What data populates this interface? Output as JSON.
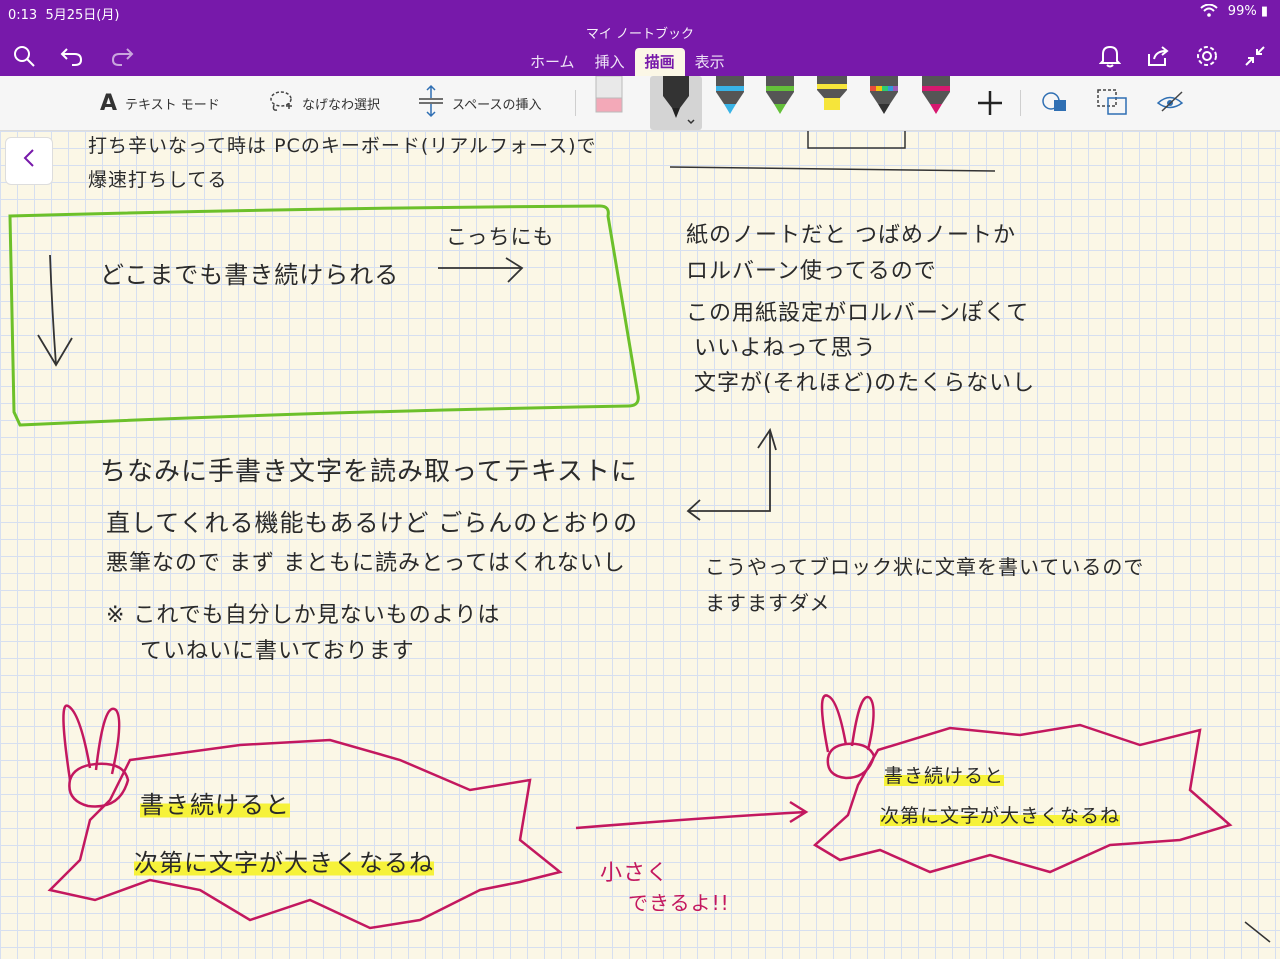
{
  "status": {
    "time": "0:13",
    "date": "5月25日(月)",
    "battery": "99%"
  },
  "notebook_title": "マイ ノートブック",
  "tabs": [
    "ホーム",
    "挿入",
    "描画",
    "表示"
  ],
  "active_tab": "描画",
  "ribbon": {
    "text_mode": "テキスト モード",
    "lasso": "なげなわ選択",
    "space": "スペースの挿入"
  },
  "pens": [
    {
      "name": "black-pen",
      "color": "#222222"
    },
    {
      "name": "blue-pen",
      "color": "#39b3e6"
    },
    {
      "name": "green-pen",
      "color": "#64c03a"
    },
    {
      "name": "yellow-highlighter",
      "color": "#f6e53a"
    },
    {
      "name": "rainbow-pen",
      "color": "#9b59b6"
    },
    {
      "name": "pink-pen",
      "color": "#d6186f"
    }
  ],
  "colors": {
    "header": "#7719aa",
    "ink_green": "#6cc02a",
    "ink_pink": "#c3185f",
    "highlight": "#f6f23a"
  },
  "notes": {
    "top_left_1": "打ち辛いなって時は PCのキーボード(リアルフォース)で",
    "top_left_2": "爆速打ちしてる",
    "box_main": "どこまでも書き続けられる",
    "box_side": "こっちにも",
    "right_1": "紙のノートだと つばめノートか",
    "right_2": "ロルバーン使ってるので",
    "right_3": "この用紙設定がロルバーンぽくて",
    "right_4": "いいよねって思う",
    "right_5": "文字が(それほど)のたくらないし",
    "mid_1": "ちなみに手書き文字を読み取ってテキストに",
    "mid_2": "直してくれる機能もあるけど ごらんのとおりの",
    "mid_3": "悪筆なので まず まともに読みとってはくれないし",
    "mid_4": "※ これでも自分しか見ないものよりは",
    "mid_5": "ていねいに書いております",
    "block_note_1": "こうやってブロック状に文章を書いているので",
    "block_note_2": "ますますダメ",
    "bubble_left_1": "書き続けると",
    "bubble_left_2": "次第に文字が大きくなるね",
    "small_1": "小さく",
    "small_2": "できるよ!!",
    "bubble_right_1": "書き続けると",
    "bubble_right_2": "次第に文字が大きくなるね"
  }
}
